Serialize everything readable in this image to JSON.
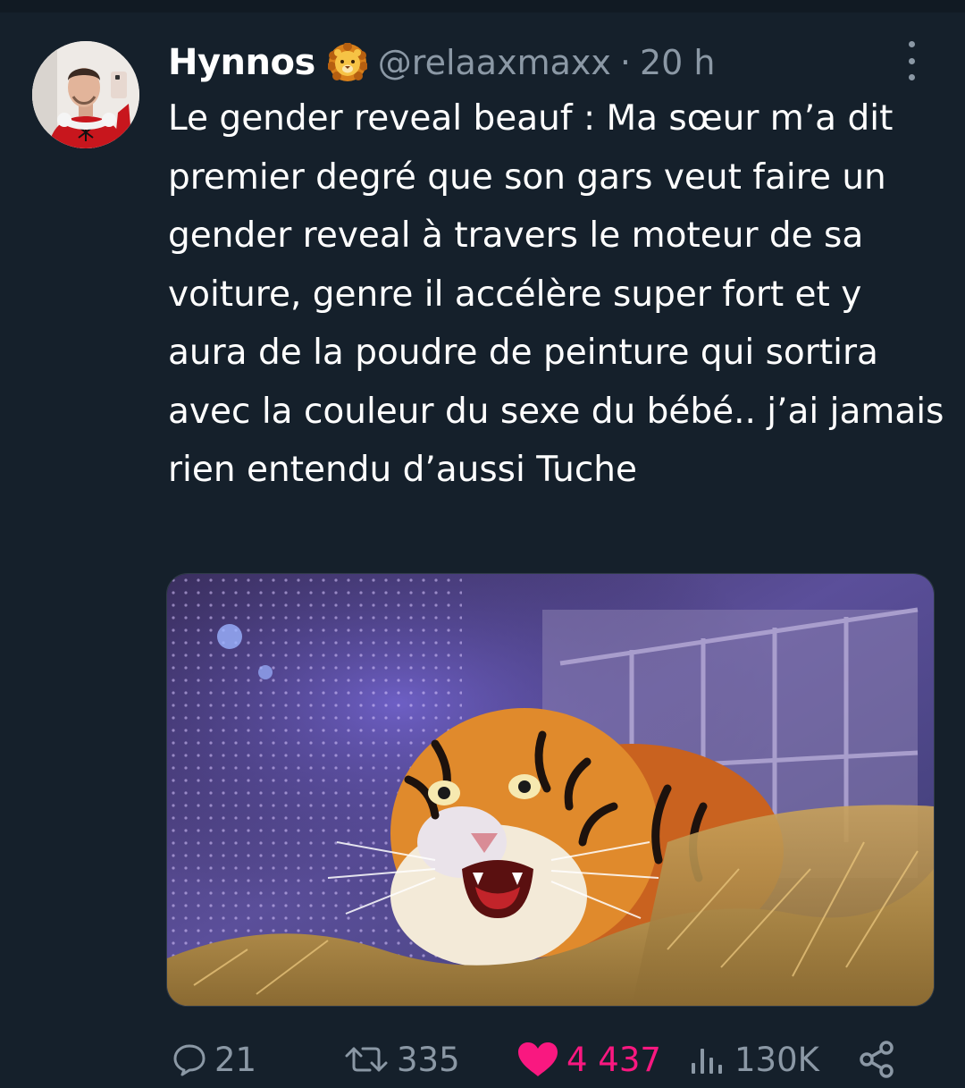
{
  "tweet": {
    "author": {
      "display_name": "Hynnos",
      "badge_emoji": "lion-face",
      "handle": "@relaaxmaxx",
      "separator": "·",
      "time": "20 h"
    },
    "text": "Le gender reveal beauf : Ma sœur m’a dit premier degré que son gars veut faire un gender reveal à travers le moteur de sa voiture, genre il accélère super fort et y aura de la poudre de peinture qui sortira avec la couleur du sexe du bébé.. j’ai jamais rien entendu d’aussi Tuche",
    "media": {
      "subject": "tiger-in-cage-photo"
    },
    "actions": {
      "replies": "21",
      "retweets": "335",
      "likes": "4 437",
      "views": "130K"
    }
  },
  "colors": {
    "background": "#15202b",
    "secondary_text": "#8b98a5",
    "like_pink": "#f91880"
  }
}
